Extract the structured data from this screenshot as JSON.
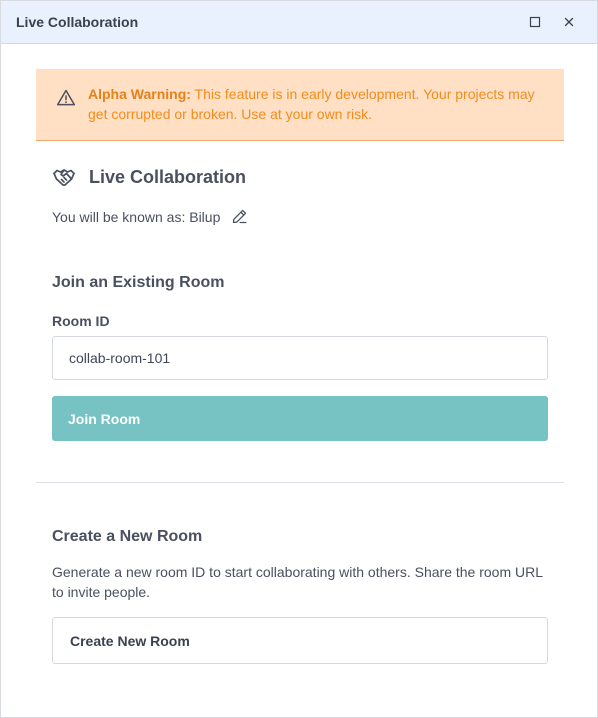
{
  "window": {
    "title": "Live Collaboration",
    "icons": {
      "maximize": "maximize-icon",
      "close": "close-icon"
    }
  },
  "alert": {
    "icon": "warning-icon",
    "strong": "Alpha Warning:",
    "message": " This feature is in early development. Your projects may get corrupted or broken. Use at your own risk.",
    "colors": {
      "background": "#ffe0c4",
      "text": "#f28c1c"
    }
  },
  "header": {
    "icon": "handshake-icon",
    "title": "Live Collaboration"
  },
  "identity": {
    "text": "You will be known as: Bilup",
    "edit_icon": "pencil-icon"
  },
  "join": {
    "title": "Join an Existing Room",
    "room_label": "Room ID",
    "room_value": "collab-room-101",
    "button_label": "Join Room",
    "button_color": "#77c2c3"
  },
  "create": {
    "title": "Create a New Room",
    "description": "Generate a new room ID to start collaborating with others. Share the room URL to invite people.",
    "button_label": "Create New Room"
  }
}
